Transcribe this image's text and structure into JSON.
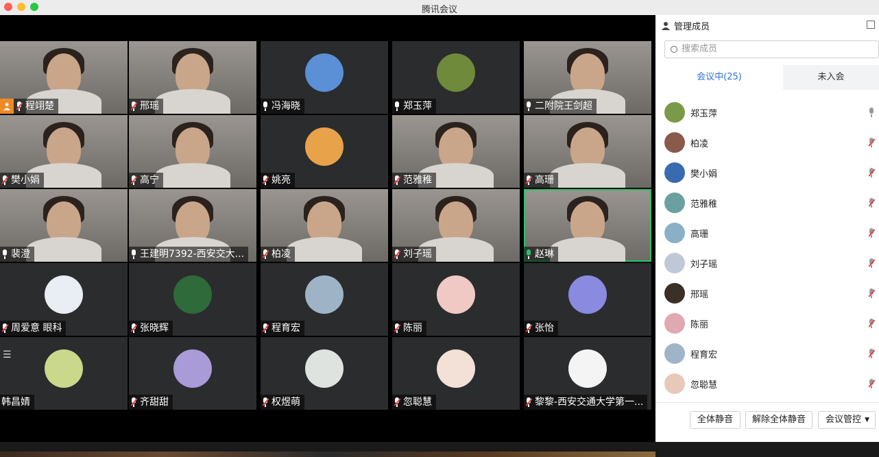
{
  "window": {
    "title": "腾讯会议"
  },
  "colors": {
    "close": "#fe5f57",
    "minimize": "#febc2e",
    "zoom": "#28c840",
    "active_speaker": "#29c36a",
    "accent": "#2a70e0"
  },
  "tiles": [
    {
      "name": "程翊楚",
      "kind": "camera",
      "mic": "muted",
      "host": true
    },
    {
      "name": "邢瑶",
      "kind": "camera",
      "mic": "muted"
    },
    {
      "name": "冯海晓",
      "kind": "avatar",
      "mic": "idle",
      "avatar_color": "#5b8fd6"
    },
    {
      "name": "郑玉萍",
      "kind": "avatar",
      "mic": "idle",
      "avatar_color": "#6f8a3a"
    },
    {
      "name": "二附院王剑超",
      "kind": "camera",
      "mic": "idle"
    },
    {
      "name": "樊小娟",
      "kind": "camera",
      "mic": "muted"
    },
    {
      "name": "高宁",
      "kind": "camera",
      "mic": "muted"
    },
    {
      "name": "姚亮",
      "kind": "avatar",
      "mic": "muted",
      "avatar_color": "#e8a24a"
    },
    {
      "name": "范雅稚",
      "kind": "camera",
      "mic": "muted"
    },
    {
      "name": "高珊",
      "kind": "camera",
      "mic": "muted"
    },
    {
      "name": "裴澄",
      "kind": "camera",
      "mic": "idle"
    },
    {
      "name": "王建明7392-西安交大...",
      "kind": "camera",
      "mic": "idle"
    },
    {
      "name": "柏凌",
      "kind": "camera",
      "mic": "muted"
    },
    {
      "name": "刘子瑶",
      "kind": "camera",
      "mic": "muted"
    },
    {
      "name": "赵琳",
      "kind": "camera",
      "mic": "on",
      "active": true
    },
    {
      "name": "周爱意 眼科",
      "kind": "avatar",
      "mic": "muted",
      "avatar_color": "#e9eef5"
    },
    {
      "name": "张晓辉",
      "kind": "avatar",
      "mic": "muted",
      "avatar_color": "#2f6a3a"
    },
    {
      "name": "程育宏",
      "kind": "avatar",
      "mic": "muted",
      "avatar_color": "#9fb3c6"
    },
    {
      "name": "陈丽",
      "kind": "avatar",
      "mic": "muted",
      "avatar_color": "#f0c9c4"
    },
    {
      "name": "张怡",
      "kind": "avatar",
      "mic": "muted",
      "avatar_color": "#8a8ae0"
    },
    {
      "name": "韩昌婧",
      "kind": "avatar",
      "mic": "none",
      "avatar_color": "#c9d88a"
    },
    {
      "name": "齐甜甜",
      "kind": "avatar",
      "mic": "muted",
      "avatar_color": "#a99ad8"
    },
    {
      "name": "权煜萌",
      "kind": "avatar",
      "mic": "muted",
      "avatar_color": "#dfe3e0"
    },
    {
      "name": "忽聪慧",
      "kind": "avatar",
      "mic": "muted",
      "avatar_color": "#f3e0d6"
    },
    {
      "name": "黎黎-西安交通大学第一...",
      "kind": "avatar",
      "mic": "muted",
      "avatar_color": "#f4f4f4"
    }
  ],
  "panel": {
    "title": "管理成员",
    "search_placeholder": "搜索成员",
    "tab_in_meeting": "会议中(25)",
    "tab_not_joined": "未入会",
    "members": [
      {
        "name": "郑玉萍",
        "mic": "idle",
        "avatar_color": "#7a9a4a"
      },
      {
        "name": "柏凌",
        "mic": "muted",
        "avatar_color": "#8a5a4a"
      },
      {
        "name": "樊小娟",
        "mic": "muted",
        "avatar_color": "#3a6ab0"
      },
      {
        "name": "范雅稚",
        "mic": "muted",
        "avatar_color": "#6aa0a0"
      },
      {
        "name": "高珊",
        "mic": "muted",
        "avatar_color": "#8ab0c8"
      },
      {
        "name": "刘子瑶",
        "mic": "muted",
        "avatar_color": "#c0c8d8"
      },
      {
        "name": "邢瑶",
        "mic": "muted",
        "avatar_color": "#3a3028"
      },
      {
        "name": "陈丽",
        "mic": "muted",
        "avatar_color": "#e0a8b0"
      },
      {
        "name": "程育宏",
        "mic": "muted",
        "avatar_color": "#a0b4c8"
      },
      {
        "name": "忽聪慧",
        "mic": "muted",
        "avatar_color": "#e8c8b8"
      }
    ],
    "btn_mute_all": "全体静音",
    "btn_unmute_all": "解除全体静音",
    "btn_control": "会议管控"
  }
}
